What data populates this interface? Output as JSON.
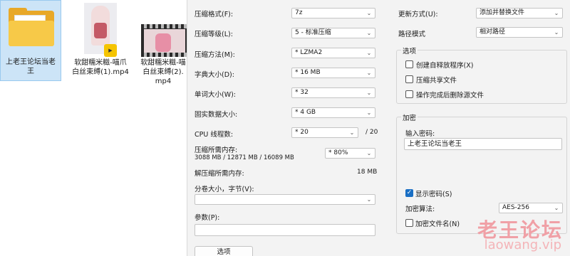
{
  "desktop": {
    "files": [
      {
        "label": "上老王论坛当老王"
      },
      {
        "label": "软甜糯米糍-喵爪白丝束缚(1).mp4",
        "badge": "Player"
      },
      {
        "label": "软甜糯米糍-喵白丝束缚(2).mp4"
      }
    ]
  },
  "dialog": {
    "left": {
      "format_label": "压缩格式(F):",
      "format_value": "7z",
      "level_label": "压缩等级(L):",
      "level_value": "5 - 标准压缩",
      "method_label": "压缩方法(M):",
      "method_value": "* LZMA2",
      "dict_label": "字典大小(D):",
      "dict_value": "* 16 MB",
      "word_label": "单词大小(W):",
      "word_value": "* 32",
      "solid_label": "固实数据大小:",
      "solid_value": "* 4 GB",
      "cpu_label": "CPU 线程数:",
      "cpu_value": "* 20",
      "cpu_total": "/ 20",
      "mem_label": "压缩所需内存:",
      "mem_detail": "3088 MB / 12871 MB / 16089 MB",
      "mem_value": "* 80%",
      "decomp_label": "解压缩所需内存:",
      "decomp_value": "18 MB",
      "split_label": "分卷大小，字节(V):",
      "split_value": "",
      "params_label": "参数(P):",
      "params_value": "",
      "options_button": "选项"
    },
    "right": {
      "update_label": "更新方式(U):",
      "update_value": "添加并替换文件",
      "path_label": "路径模式",
      "path_value": "相对路径",
      "options_group": "选项",
      "opt_sfx": "创建自释放程序(X)",
      "opt_shared": "压缩共享文件",
      "opt_delete": "操作完成后删除源文件",
      "encrypt_group": "加密",
      "password_label": "输入密码:",
      "password_value": "上老王论坛当老王",
      "show_password": "显示密码(S)",
      "algo_label": "加密算法:",
      "algo_value": "AES-256",
      "encrypt_names": "加密文件名(N)"
    }
  },
  "watermark": {
    "cn": "老王论坛",
    "en": "laowang.vip"
  },
  "colors": {
    "folder": "#f7c948",
    "selection": "#cce4f7",
    "checkbox_checked": "#1a6fc4",
    "watermark": "#f0a0a6"
  },
  "state": {
    "show_password_checked": true,
    "sfx_checked": false,
    "shared_checked": false,
    "delete_checked": false,
    "encrypt_names_checked": false
  }
}
